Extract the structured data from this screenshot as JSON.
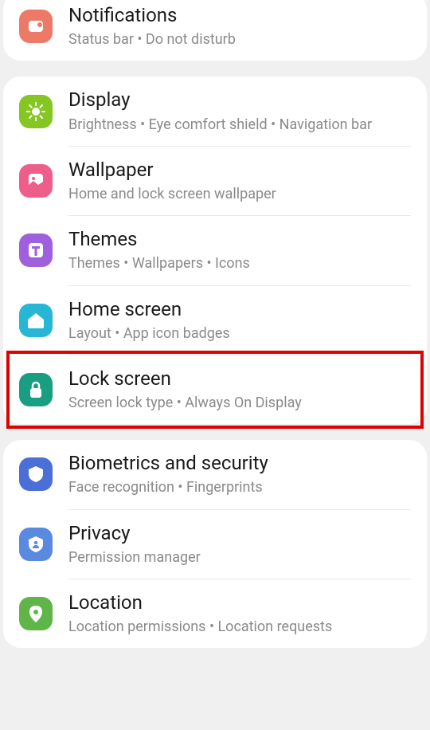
{
  "sections": [
    {
      "items": [
        {
          "id": "notifications",
          "title": "Notifications",
          "subtitle": "Status bar  •  Do not disturb",
          "iconClass": "c-notif",
          "highlighted": false
        }
      ]
    },
    {
      "items": [
        {
          "id": "display",
          "title": "Display",
          "subtitle": "Brightness  •  Eye comfort shield  •  Navigation bar",
          "iconClass": "c-display",
          "highlighted": false
        },
        {
          "id": "wallpaper",
          "title": "Wallpaper",
          "subtitle": "Home and lock screen wallpaper",
          "iconClass": "c-wall",
          "highlighted": false
        },
        {
          "id": "themes",
          "title": "Themes",
          "subtitle": "Themes  •  Wallpapers  •  Icons",
          "iconClass": "c-themes",
          "highlighted": false
        },
        {
          "id": "home-screen",
          "title": "Home screen",
          "subtitle": "Layout  •  App icon badges",
          "iconClass": "c-home",
          "highlighted": false
        },
        {
          "id": "lock-screen",
          "title": "Lock screen",
          "subtitle": "Screen lock type  •  Always On Display",
          "iconClass": "c-lock",
          "highlighted": true
        }
      ]
    },
    {
      "items": [
        {
          "id": "biometrics",
          "title": "Biometrics and security",
          "subtitle": "Face recognition  •  Fingerprints",
          "iconClass": "c-bio",
          "highlighted": false
        },
        {
          "id": "privacy",
          "title": "Privacy",
          "subtitle": "Permission manager",
          "iconClass": "c-priv",
          "highlighted": false
        },
        {
          "id": "location",
          "title": "Location",
          "subtitle": "Location permissions  •  Location requests",
          "iconClass": "c-loc",
          "highlighted": false
        }
      ]
    }
  ]
}
